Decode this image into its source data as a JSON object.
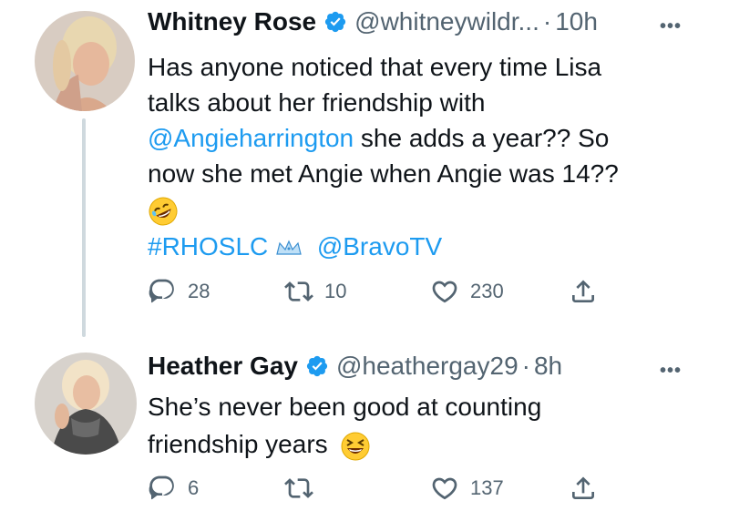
{
  "tweets": [
    {
      "name": "Whitney Rose",
      "handle": "@whitneywildr...",
      "separator": "·",
      "time": "10h",
      "more": "•••",
      "text_lines": [
        "Has anyone noticed that every time Lisa",
        "talks about her friendship with",
        "she adds a year?? So",
        "now she met Angie when Angie was 14??"
      ],
      "mention": "@Angieharrington",
      "hashtag": "#RHOSLC",
      "tag_mention": "@BravoTV",
      "replies": "28",
      "retweets": "10",
      "likes": "230"
    },
    {
      "name": "Heather Gay",
      "handle": "@heathergay29",
      "separator": "·",
      "time": "8h",
      "more": "•••",
      "text_lines": [
        "She’s never been good at counting",
        "friendship years"
      ],
      "replies": "6",
      "retweets": "",
      "likes": "137"
    }
  ],
  "icons": {
    "reply": "reply-icon",
    "retweet": "retweet-icon",
    "like": "heart-icon",
    "share": "share-icon",
    "verified": "verified-badge-icon"
  },
  "colors": {
    "link": "#1d9bf0",
    "secondary": "#536471",
    "verified": "#1d9bf0"
  }
}
